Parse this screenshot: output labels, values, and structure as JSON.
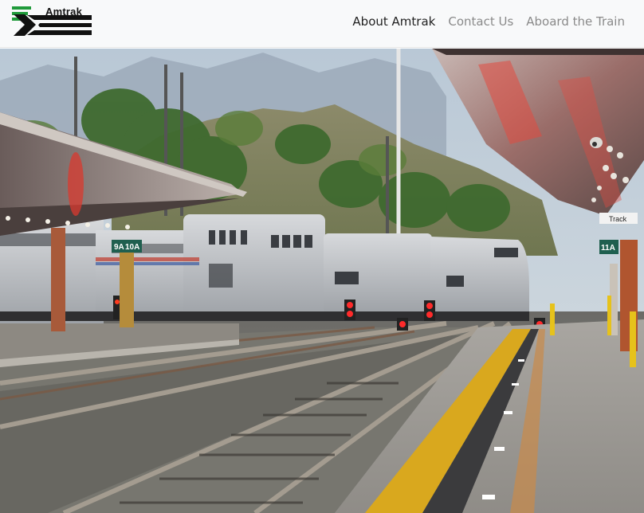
{
  "brand": {
    "name": "Amtrak"
  },
  "nav": {
    "items": [
      {
        "label": "About Amtrak",
        "active": true
      },
      {
        "label": "Contact Us",
        "active": false
      },
      {
        "label": "Aboard the Train",
        "active": false
      }
    ]
  },
  "hero": {
    "signs": {
      "track_left_a": "9A",
      "track_left_b": "10A",
      "track_right": "11A",
      "track_pointer": "Track"
    }
  },
  "colors": {
    "navbar_bg": "#f8f9fa",
    "logo_green": "#1f9a3a",
    "logo_black": "#111111",
    "nav_active": "#222222",
    "nav_inactive": "#8a8a8a"
  }
}
